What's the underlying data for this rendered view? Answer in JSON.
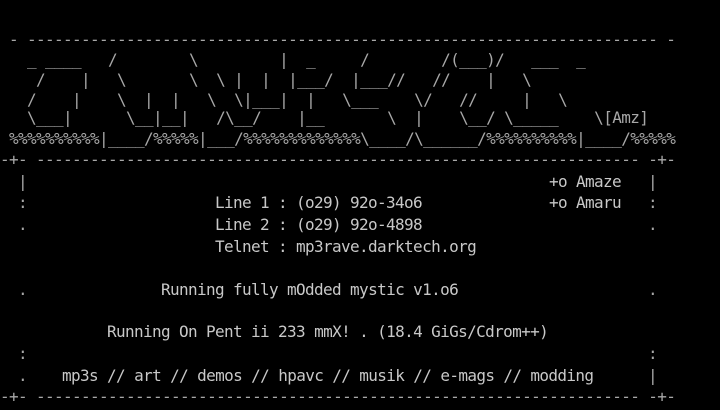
{
  "logo": {
    "rows": [
      " - ---------------------------------------------------------------------- -",
      "   _ ____   /        \\         |  _     /        /(___)/   ___  _",
      "    /    |   \\       \\  \\ |  |  |___/  |___//   //    |   \\",
      "   /    |    \\  |  |   \\  \\|___|  |   \\___    \\/   //     |   \\",
      "   \\___|      \\__|__|   /\\__/    |__       \\  |    \\__/ \\_____    \\[Amz]",
      " %%%%%%%%%%|____/%%%%%|___/%%%%%%%%%%%%%\\____/\\______/%%%%%%%%%%|____/%%%%%"
    ]
  },
  "border": {
    "top": "-+- ------------------------------------------------------------------- -+-",
    "bottom": "-+- ------------------------------------------------------------------- -+-"
  },
  "credits": {
    "amaze": "+o Amaze",
    "amaru": "+o Amaru"
  },
  "info": {
    "line1": "Line 1 : (o29) 92o-34o6",
    "line2": "Line 2 : (o29) 92o-4898",
    "telnet": "Telnet : mp3rave.darktech.org"
  },
  "software": "Running fully mOdded mystic v1.o6",
  "hardware": "Running On Pent ii 233 mmX! . (18.4 GiGs/Cdrom++)",
  "sections": {
    "mp3s": "mp3s",
    "art": "art",
    "demos": "demos",
    "hpavc": "hpavc",
    "musik": "musik",
    "emags": "e-mags",
    "modding": "modding",
    "separator": "//"
  },
  "edges": {
    "pipe": "|",
    "colon": ":",
    "dot": "."
  }
}
